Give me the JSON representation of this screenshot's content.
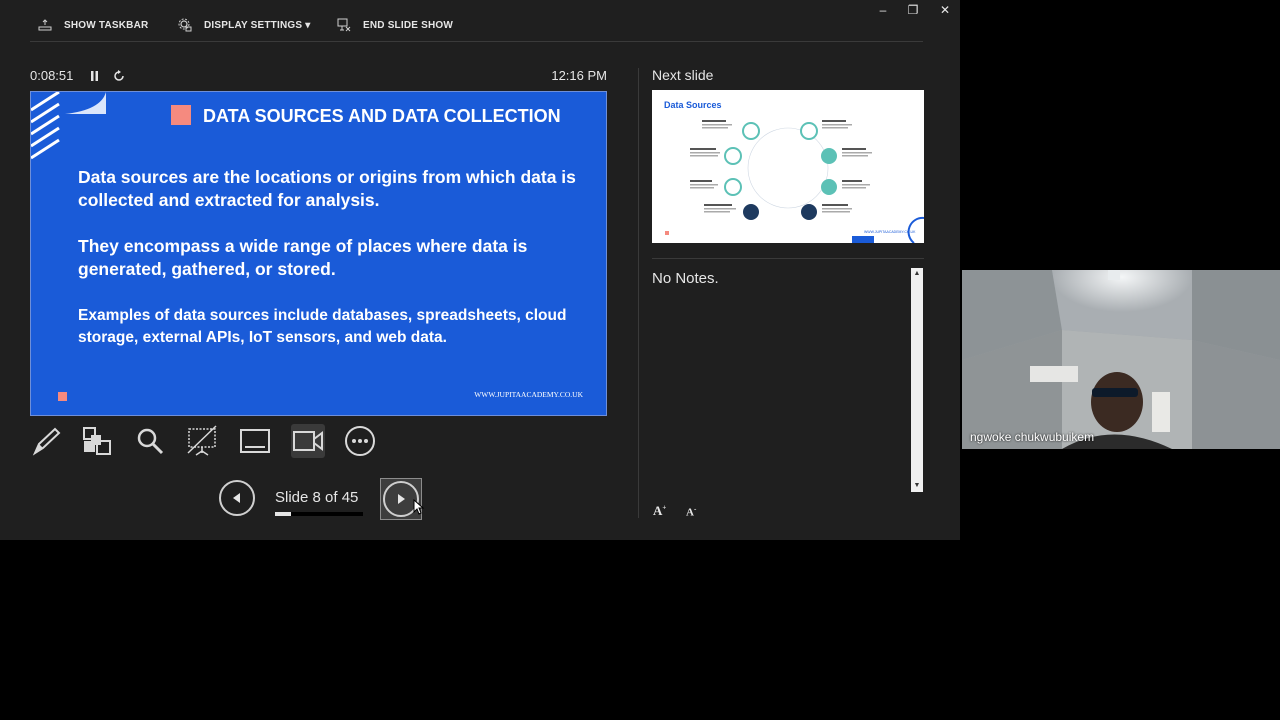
{
  "toolbar": {
    "show_taskbar": "SHOW TASKBAR",
    "display_settings": "DISPLAY SETTINGS ▾",
    "end_slide_show": "END SLIDE SHOW"
  },
  "window_controls": {
    "minimize": "–",
    "restore": "❐",
    "close": "✕"
  },
  "timer": "0:08:51",
  "clock": "12:16 PM",
  "current_slide": {
    "title": "DATA SOURCES AND DATA COLLECTION",
    "paragraph1": "Data sources are the locations or origins from which data is collected and extracted for analysis.",
    "paragraph2": "They  encompass a wide range of places where data is generated, gathered, or stored.",
    "paragraph3": "Examples of data sources include databases, spreadsheets, cloud storage, external APIs, IoT sensors, and web data.",
    "url": "WWW.JUPITAACADEMY.CO.UK",
    "colors": {
      "background": "#1a5bd8",
      "accent": "#f58a7f"
    }
  },
  "tools": [
    "pen-icon",
    "see-all-slides-icon",
    "zoom-icon",
    "black-screen-icon",
    "subtitles-icon",
    "camera-icon",
    "more-options-icon"
  ],
  "navigation": {
    "slide_counter": "Slide 8 of 45",
    "progress_fraction": 0.178
  },
  "next_slide": {
    "label": "Next slide",
    "title": "Data Sources",
    "url": "WWW.JUPITAACADEMY.CO.UK"
  },
  "notes": {
    "text": "No Notes."
  },
  "font_controls": {
    "increase": "A",
    "decrease": "A"
  },
  "video": {
    "participant_name": "ngwoke chukwubuikem"
  }
}
